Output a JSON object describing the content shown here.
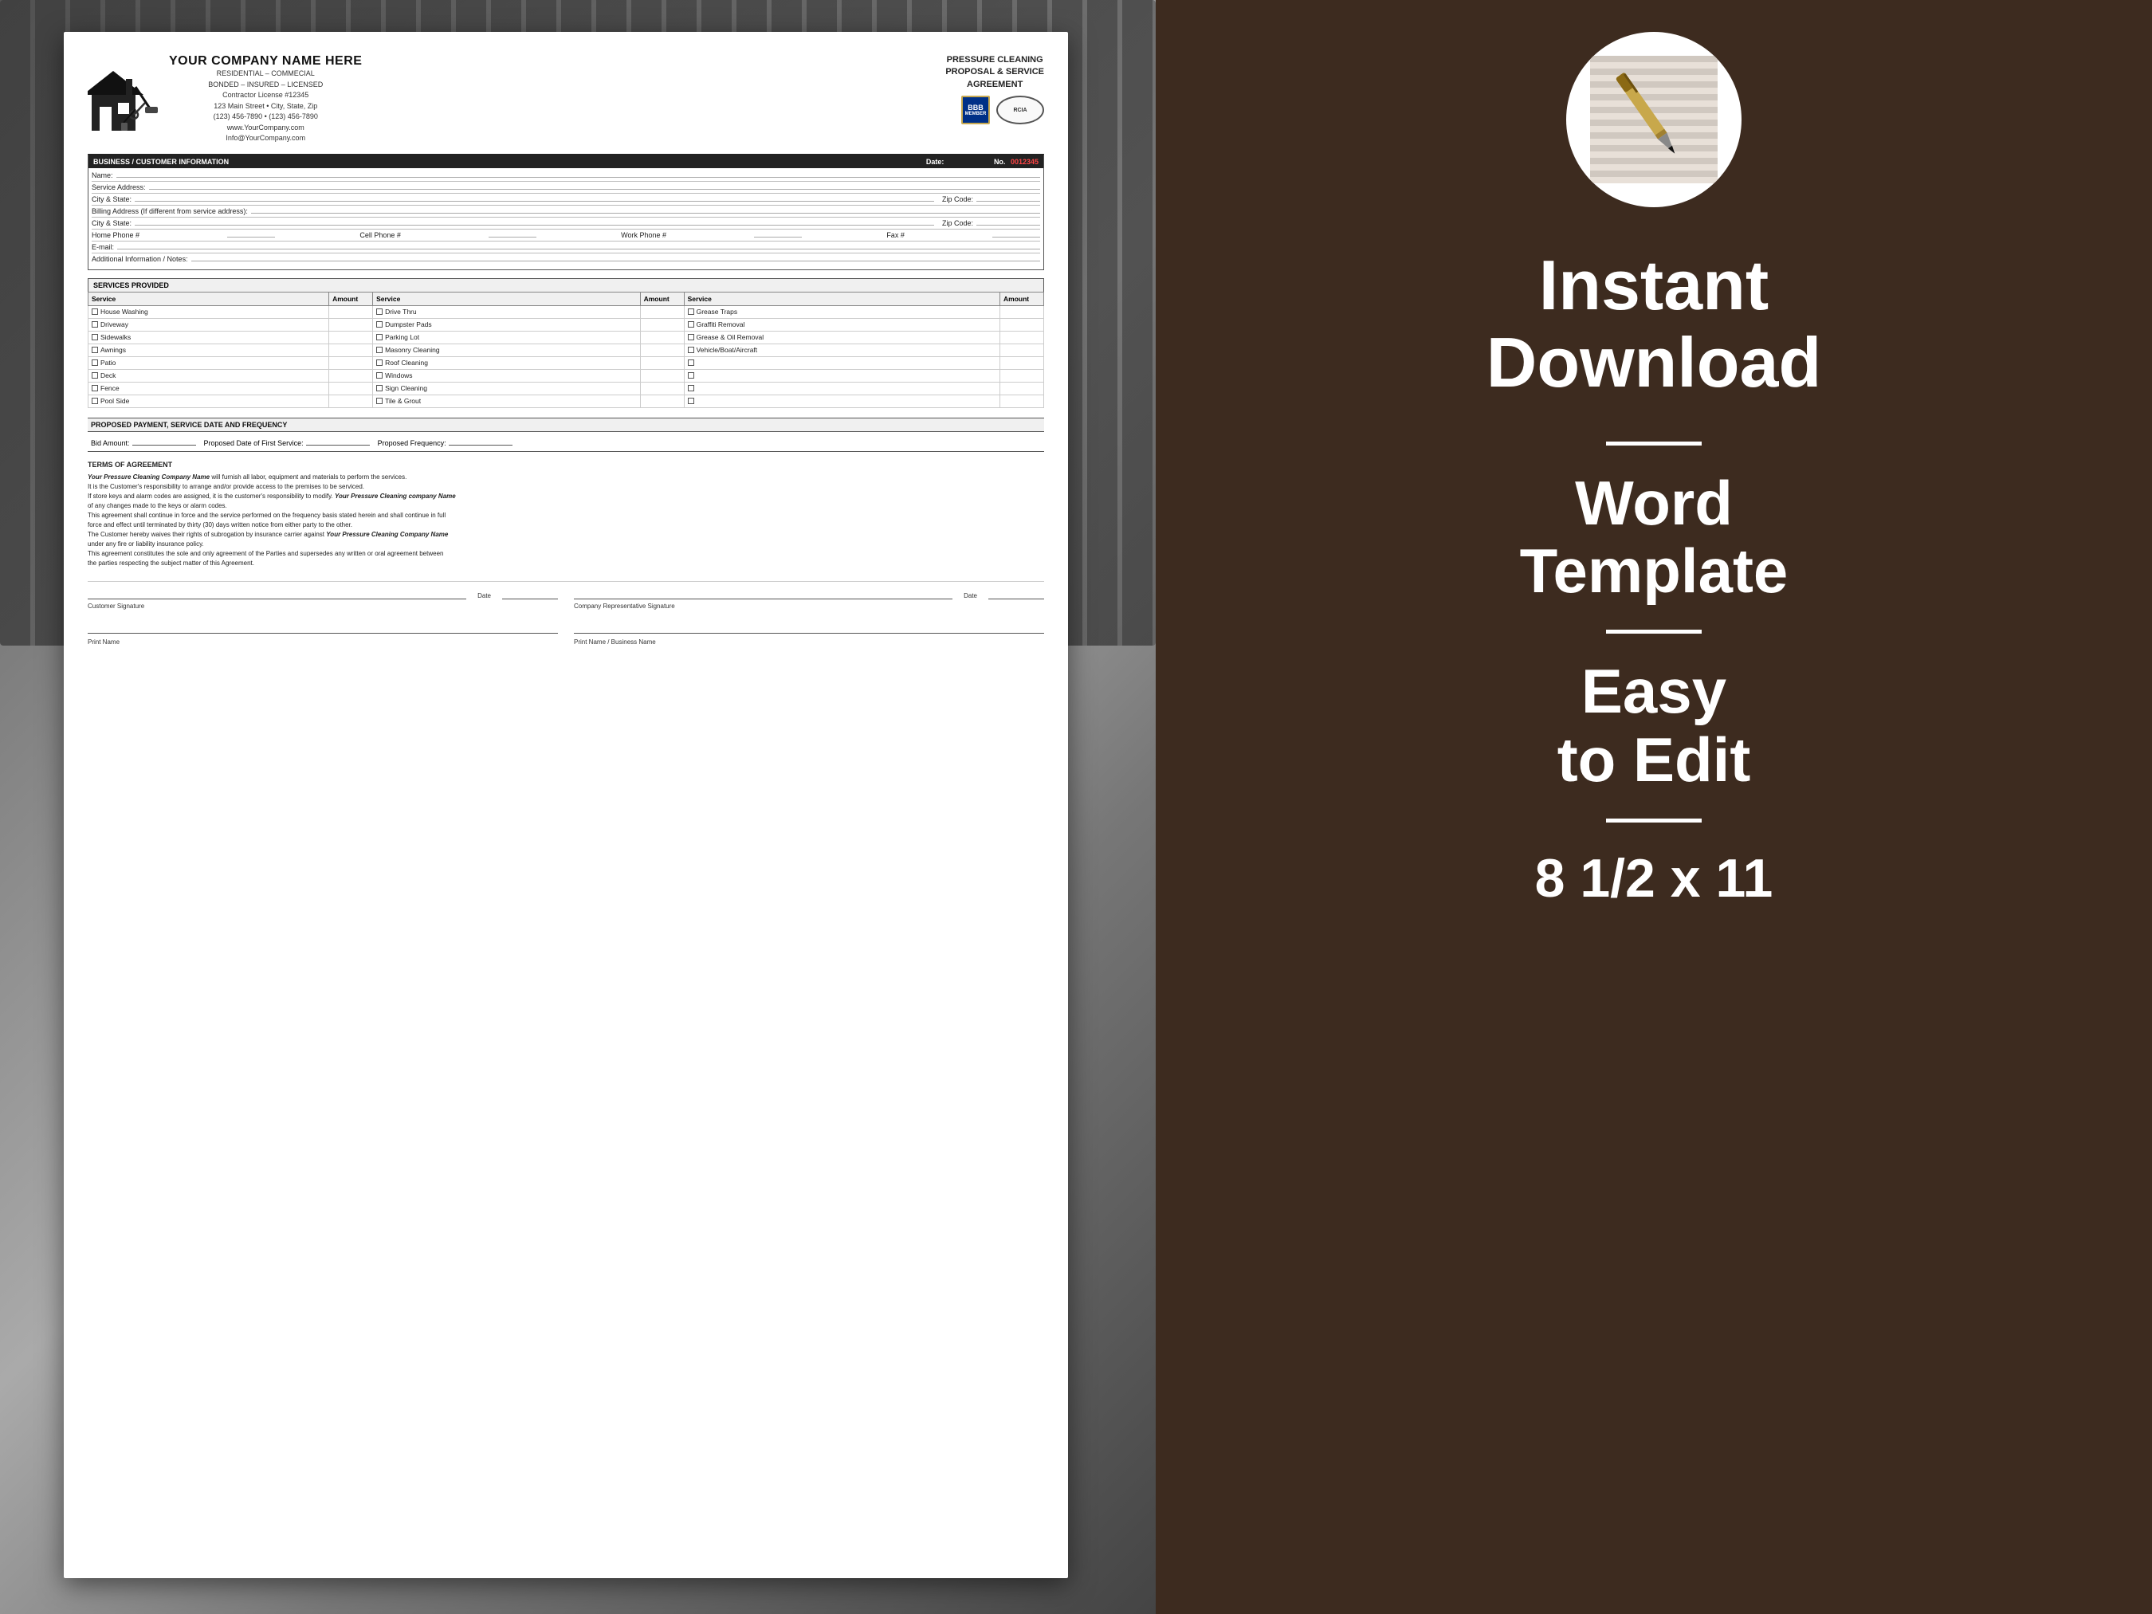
{
  "document": {
    "company_name": "YOUR COMPANY NAME HERE",
    "company_sub1": "RESIDENTIAL – COMMECIAL",
    "company_sub2": "BONDED – INSURED – LICENSED",
    "company_sub3": "Contractor License #12345",
    "company_sub4": "123 Main Street • City, State, Zip",
    "company_sub5": "(123) 456-7890 • (123) 456-7890",
    "company_sub6": "www.YourCompany.com",
    "company_sub7": "Info@YourCompany.com",
    "proposal_title_line1": "PRESSURE CLEANING",
    "proposal_title_line2": "PROPOSAL & SERVICE",
    "proposal_title_line3": "AGREEMENT",
    "bbb_label": "BBB",
    "bbb_sub": "MEMBER",
    "rcia_label": "RCIA",
    "section_customer": "BUSINESS / CUSTOMER INFORMATION",
    "date_label": "Date:",
    "no_label": "No.",
    "doc_number": "0012345",
    "name_label": "Name:",
    "service_address_label": "Service Address:",
    "city_state_label": "City & State:",
    "zip_code_label": "Zip Code:",
    "billing_address_label": "Billing Address (If different from service address):",
    "city_state2_label": "City & State:",
    "zip_code2_label": "Zip Code:",
    "home_phone_label": "Home Phone #",
    "cell_phone_label": "Cell Phone #",
    "work_phone_label": "Work Phone #",
    "fax_label": "Fax #",
    "email_label": "E-mail:",
    "additional_label": "Additional Information / Notes:",
    "section_services": "SERVICES PROVIDED",
    "services_col1_header": "Service",
    "services_col2_header": "Amount",
    "services_col3_header": "Service",
    "services_col4_header": "Amount",
    "services_col5_header": "Service",
    "services_col6_header": "Amount",
    "services_col1": [
      "House Washing",
      "Driveway",
      "Sidewalks",
      "Awnings",
      "Patio",
      "Deck",
      "Fence",
      "Pool Side"
    ],
    "services_col2": [
      "Drive Thru",
      "Dumpster Pads",
      "Parking Lot",
      "Masonry Cleaning",
      "Roof Cleaning",
      "Windows",
      "Sign Cleaning",
      "Tile & Grout"
    ],
    "services_col3": [
      "Grease Traps",
      "Graffiti Removal",
      "Grease & Oil Removal",
      "Vehicle/Boat/Aircraft",
      "",
      "",
      "",
      ""
    ],
    "section_payment": "PROPOSED PAYMENT, SERVICE DATE AND FREQUENCY",
    "bid_amount_label": "Bid Amount:",
    "proposed_date_label": "Proposed Date of First Service:",
    "proposed_freq_label": "Proposed Frequency:",
    "section_terms": "TERMS OF AGREEMENT",
    "terms_line1_pre": "",
    "terms_company_bold": "Your Pressure Cleaning Company Name",
    "terms_line1_post": " will furnish all labor, equipment and materials to perform the services.",
    "terms_line2": "It is the Customer's responsibility to arrange and/or provide access to the premises to be serviced.",
    "terms_line3_pre": "If store keys and alarm codes are assigned, it is the customer's responsibility to modify. ",
    "terms_company_bold2": "Your Pressure Cleaning company Name",
    "terms_line3_post": "",
    "terms_line4": "of any changes made to the keys or alarm codes.",
    "terms_line5": "This agreement shall continue in force and the service performed on the frequency basis stated herein and shall continue in full",
    "terms_line6": "force and effect until terminated by thirty (30) days written notice from either party to the other.",
    "terms_line7_pre": "The Customer hereby waives their rights of subrogation by insurance carrier against ",
    "terms_company_bold3": "Your Pressure Cleaning Company Name",
    "terms_line7_post": "",
    "terms_line8": "under any fire or liability insurance policy.",
    "terms_line9": "This agreement constitutes the sole and only agreement of the Parties and supersedes any written or oral agreement between",
    "terms_line10": "the parties respecting the subject matter of this Agreement.",
    "customer_sig_label": "Customer Signature",
    "date_sig_label": "Date",
    "company_sig_label": "Company Representative Signature",
    "date_sig2_label": "Date",
    "print_name_label": "Print Name",
    "print_name_biz_label": "Print Name / Business Name"
  },
  "right_panel": {
    "heading1": "Instant",
    "heading2": "Download",
    "sub1": "Word",
    "sub2": "Template",
    "easy1": "Easy",
    "easy2": "to Edit",
    "size": "8 1/2 x 11"
  }
}
